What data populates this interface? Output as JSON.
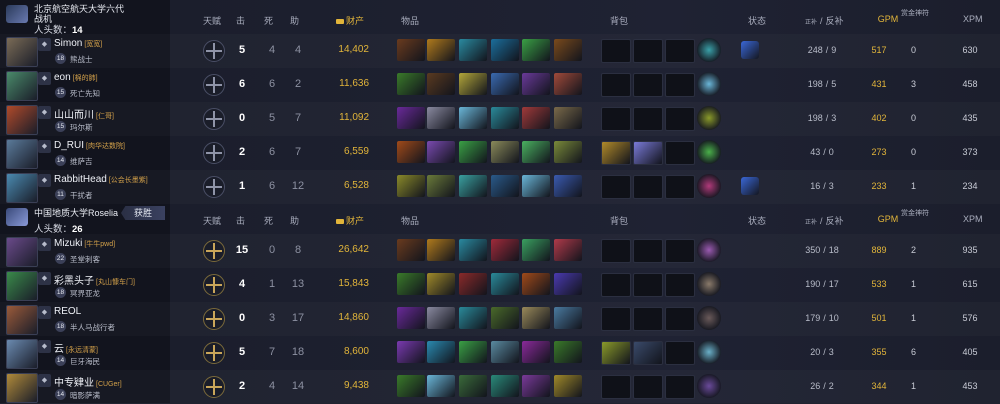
{
  "headers": {
    "talent": "天赋",
    "kills": "击",
    "deaths": "死",
    "assists": "助",
    "networth": "财产",
    "items": "物品",
    "backpack": "背包",
    "buffs": "状态",
    "lh_prefix": "正补",
    "lh_sep": "/",
    "denies_label": "反补",
    "gpm": "GPM",
    "runes": "赏金神符",
    "xpm": "XPM"
  },
  "team1": {
    "name": "北京航空航天大学六代战机",
    "kills_label": "人头数：",
    "kills": "14",
    "players": [
      {
        "name": "Simon",
        "tag": "[宽宽]",
        "rank": "",
        "level": "18",
        "hero": "熊战士",
        "k": "5",
        "d": "4",
        "a": "4",
        "networth": "14,402",
        "lh": "248",
        "dn": "9",
        "gpm": "517",
        "runes": "0",
        "xpm": "630",
        "items": [
          "#6a3b1e",
          "#b07a1c",
          "#2a8aa0",
          "#1b6e9c",
          "#3aa045",
          "#7a4a1c"
        ],
        "bag": [
          0,
          0,
          0
        ],
        "neutral": "#3aa0a8",
        "buff": "#3a68d8",
        "avatar": "#7a6b56"
      },
      {
        "name": "eon",
        "tag": "[棉的肺]",
        "rank": "",
        "level": "15",
        "hero": "死亡先知",
        "k": "6",
        "d": "6",
        "a": "2",
        "networth": "11,636",
        "lh": "198",
        "dn": "5",
        "gpm": "431",
        "runes": "3",
        "xpm": "458",
        "items": [
          "#3a7a2a",
          "#5a3a20",
          "#b2a63a",
          "#3a6ab0",
          "#6a3a9a",
          "#a04a3a"
        ],
        "bag": [
          0,
          0,
          0
        ],
        "neutral": "#6ab6d8",
        "buff": "",
        "avatar": "#4a8a6a"
      },
      {
        "name": "山山而川",
        "tag": "[仁哥]",
        "rank": "",
        "level": "15",
        "hero": "玛尔斯",
        "k": "0",
        "d": "5",
        "a": "7",
        "networth": "11,092",
        "lh": "198",
        "dn": "3",
        "gpm": "402",
        "runes": "0",
        "xpm": "435",
        "items": [
          "#6a2a9a",
          "#8a8aa0",
          "#6ab6d8",
          "#2a8a9a",
          "#a03a3a",
          "#7a6a4a"
        ],
        "bag": [
          0,
          0,
          0
        ],
        "neutral": "#8a9a2a",
        "buff": "",
        "avatar": "#b04a2a"
      },
      {
        "name": "D_RUI",
        "tag": "[肉华达数院]",
        "rank": "",
        "level": "14",
        "hero": "维萨吉",
        "k": "2",
        "d": "6",
        "a": "7",
        "networth": "6,559",
        "lh": "43",
        "dn": "0",
        "gpm": "273",
        "runes": "0",
        "xpm": "373",
        "items": [
          "#a04a1a",
          "#7a4ab0",
          "#3aa045",
          "#8a8a5a",
          "#4ab060",
          "#7a8a3a"
        ],
        "bag": [
          "#b08a2a",
          "#7a7ad8",
          0
        ],
        "neutral": "#4ab04a",
        "buff": "",
        "avatar": "#5a7a9a"
      },
      {
        "name": "RabbitHead",
        "tag": "[公会长墨紫]",
        "rank": "",
        "level": "11",
        "hero": "干扰者",
        "k": "1",
        "d": "6",
        "a": "12",
        "networth": "6,528",
        "lh": "16",
        "dn": "3",
        "gpm": "233",
        "runes": "1",
        "xpm": "234",
        "items": [
          "#8a8a2a",
          "#6a7a3a",
          "#3aa0a0",
          "#2a5a8a",
          "#6ab6d8",
          "#3a5ab0"
        ],
        "bag": [
          0,
          0,
          0
        ],
        "neutral": "#b03a7a",
        "buff": "#3a68d8",
        "avatar": "#4a8ab0"
      }
    ]
  },
  "team2": {
    "name": "中国地质大学Roselia",
    "win_label": "获胜",
    "kills_label": "人头数：",
    "kills": "26",
    "players": [
      {
        "name": "Mizuki",
        "tag": "[牛牛pwd]",
        "rank": "",
        "level": "22",
        "hero": "圣堂刺客",
        "k": "15",
        "d": "0",
        "a": "8",
        "networth": "26,642",
        "lh": "350",
        "dn": "18",
        "gpm": "889",
        "runes": "2",
        "xpm": "935",
        "items": [
          "#6a3b1e",
          "#b07a1c",
          "#2a8aa0",
          "#a02a3a",
          "#3aa060",
          "#b03a4a"
        ],
        "bag": [
          0,
          0,
          0
        ],
        "neutral": "#9a5ab0",
        "buff": "",
        "avatar": "#6a4a8a"
      },
      {
        "name": "彩黑头子",
        "tag": "[丸山慷车门]",
        "rank": "",
        "level": "18",
        "hero": "冥界亚龙",
        "k": "4",
        "d": "1",
        "a": "13",
        "networth": "15,843",
        "lh": "190",
        "dn": "17",
        "gpm": "533",
        "runes": "1",
        "xpm": "615",
        "items": [
          "#3a7a2a",
          "#a08a2a",
          "#8a2a2a",
          "#2a8a9a",
          "#a04a1a",
          "#4a3ab0"
        ],
        "bag": [
          0,
          0,
          0
        ],
        "neutral": "#8a7a6a",
        "buff": "",
        "avatar": "#3a8a4a"
      },
      {
        "name": "REOL",
        "tag": "",
        "rank": "",
        "level": "18",
        "hero": "半人马战行者",
        "k": "0",
        "d": "3",
        "a": "17",
        "networth": "14,860",
        "lh": "179",
        "dn": "10",
        "gpm": "501",
        "runes": "1",
        "xpm": "576",
        "items": [
          "#6a2a9a",
          "#8a8aa0",
          "#2a8a9a",
          "#4a6a2a",
          "#9a8a5a",
          "#4a7aa0"
        ],
        "bag": [
          0,
          0,
          0
        ],
        "neutral": "#6a5a5a",
        "buff": "",
        "avatar": "#9a5a3a"
      },
      {
        "name": "云",
        "tag": "[永远清蒙]",
        "rank": "",
        "level": "14",
        "hero": "巨牙海民",
        "k": "5",
        "d": "7",
        "a": "18",
        "networth": "8,600",
        "lh": "20",
        "dn": "3",
        "gpm": "355",
        "runes": "6",
        "xpm": "405",
        "items": [
          "#7a3ab0",
          "#2a8ab0",
          "#3aa045",
          "#5a8aa0",
          "#8a2a9a",
          "#3a7a2a"
        ],
        "bag": [
          "#8a9a2a",
          "#3a4a6a",
          0
        ],
        "neutral": "#6ab0c8",
        "buff": "",
        "avatar": "#6a8ab0"
      },
      {
        "name": "中专肄业",
        "tag": "[CUGer]",
        "rank": "",
        "level": "14",
        "hero": "暗影萨满",
        "k": "2",
        "d": "4",
        "a": "14",
        "networth": "9,438",
        "lh": "26",
        "dn": "2",
        "gpm": "344",
        "runes": "1",
        "xpm": "453",
        "items": [
          "#3a7a2a",
          "#6ab6d8",
          "#3a6a3a",
          "#2a8a7a",
          "#7a3a9a",
          "#a08a2a"
        ],
        "bag": [
          0,
          0,
          0
        ],
        "neutral": "#6a4a9a",
        "buff": "",
        "avatar": "#b08a3a"
      }
    ]
  }
}
